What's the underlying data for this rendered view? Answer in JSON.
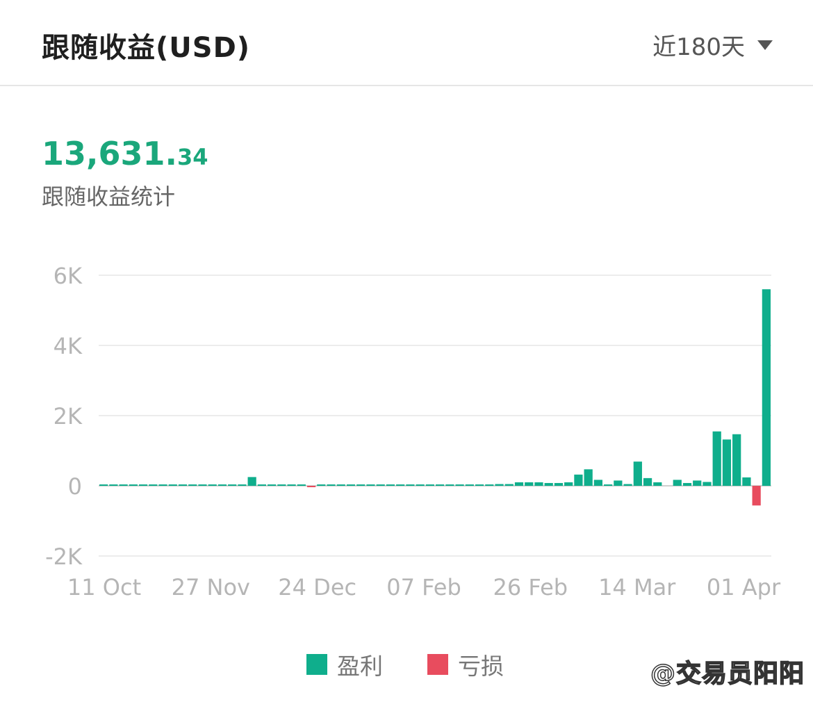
{
  "header": {
    "title": "跟随收益(USD)",
    "period_label": "近180天"
  },
  "summary": {
    "total_int": "13,631.",
    "total_dec": "34",
    "caption": "跟随收益统计"
  },
  "legend": {
    "profit_label": "盈利",
    "loss_label": "亏损"
  },
  "colors": {
    "profit": "#0fae8c",
    "loss": "#e84c5e",
    "total_text": "#1aa77b"
  },
  "watermark": "@交易员阳阳",
  "chart_data": {
    "type": "bar",
    "title": "",
    "xlabel": "",
    "ylabel": "",
    "ylim": [
      -2000,
      6000
    ],
    "yticks": [
      6000,
      4000,
      2000,
      0,
      -2000
    ],
    "ytick_labels": [
      "6K",
      "4K",
      "2K",
      "0",
      "-2K"
    ],
    "xtick_labels": [
      "11 Oct",
      "27 Nov",
      "24 Dec",
      "07 Feb",
      "26 Feb",
      "14 Mar",
      "01 Apr"
    ],
    "grid": true,
    "legend_position": "bottom-center",
    "series": [
      {
        "name": "盈利",
        "values": [
          20,
          15,
          10,
          5,
          5,
          5,
          8,
          10,
          5,
          10,
          15,
          20,
          25,
          5,
          5,
          250,
          5,
          15,
          15,
          15,
          10,
          0,
          10,
          15,
          25,
          5,
          5,
          15,
          15,
          5,
          5,
          5,
          10,
          15,
          10,
          10,
          15,
          25,
          25,
          25,
          50,
          50,
          100,
          100,
          100,
          80,
          80,
          100,
          320,
          470,
          170,
          20,
          150,
          50,
          690,
          220,
          100,
          0,
          170,
          80,
          150,
          110,
          1550,
          1320,
          1470,
          240,
          0,
          5600
        ]
      },
      {
        "name": "亏损",
        "values": [
          0,
          0,
          0,
          0,
          0,
          0,
          0,
          0,
          0,
          0,
          0,
          0,
          0,
          0,
          0,
          0,
          0,
          0,
          0,
          0,
          0,
          -30,
          0,
          0,
          0,
          0,
          0,
          0,
          0,
          0,
          0,
          0,
          0,
          0,
          0,
          0,
          0,
          0,
          0,
          0,
          0,
          0,
          0,
          0,
          0,
          0,
          0,
          0,
          0,
          0,
          0,
          0,
          0,
          0,
          0,
          0,
          0,
          0,
          0,
          0,
          0,
          0,
          0,
          0,
          0,
          0,
          -560,
          0
        ]
      }
    ]
  }
}
